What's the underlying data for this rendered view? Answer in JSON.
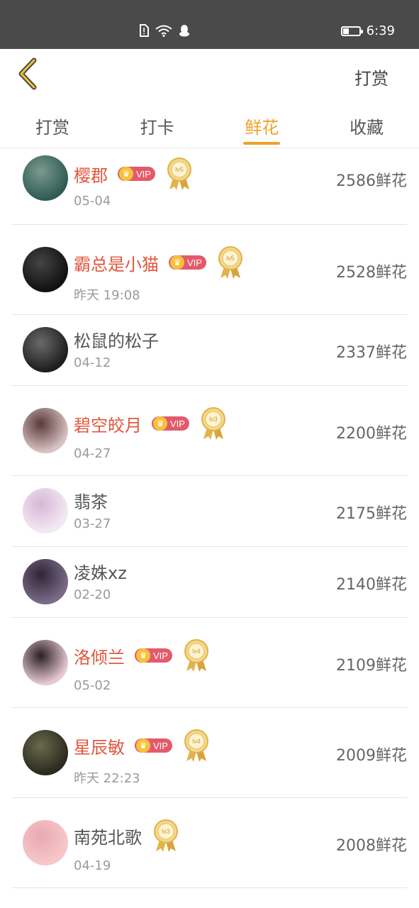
{
  "status_bar": {
    "time": "6:39"
  },
  "header": {
    "right_action": "打赏"
  },
  "tabs": [
    {
      "label": "打赏",
      "active": false
    },
    {
      "label": "打卡",
      "active": false
    },
    {
      "label": "鲜花",
      "active": true
    },
    {
      "label": "收藏",
      "active": false
    }
  ],
  "colors": {
    "accent": "#f0a12a",
    "vip_name": "#e0563e",
    "vip_badge": "#e45a6a",
    "medal": "#e2b24c"
  },
  "list": [
    {
      "name": "樱郡",
      "date": "05-04",
      "amount": "2586鲜花",
      "vip": true,
      "vip_label": "VIP",
      "level": "lv5"
    },
    {
      "name": "霸总是小猫",
      "date": "昨天 19:08",
      "amount": "2528鲜花",
      "vip": true,
      "vip_label": "VIP",
      "level": "lv5"
    },
    {
      "name": "松鼠的松子",
      "date": "04-12",
      "amount": "2337鲜花",
      "vip": false
    },
    {
      "name": "碧空皎月",
      "date": "04-27",
      "amount": "2200鲜花",
      "vip": true,
      "vip_label": "VIP",
      "level": "lv3"
    },
    {
      "name": "翡茶",
      "date": "03-27",
      "amount": "2175鲜花",
      "vip": false
    },
    {
      "name": "凌姝xz",
      "date": "02-20",
      "amount": "2140鲜花",
      "vip": false
    },
    {
      "name": "洛倾兰",
      "date": "05-02",
      "amount": "2109鲜花",
      "vip": true,
      "vip_label": "VIP",
      "level": "lv4"
    },
    {
      "name": "星辰敏",
      "date": "昨天 22:23",
      "amount": "2009鲜花",
      "vip": true,
      "vip_label": "VIP",
      "level": "lv4"
    },
    {
      "name": "南苑北歌",
      "date": "04-19",
      "amount": "2008鲜花",
      "vip": false,
      "level": "lv3"
    }
  ]
}
